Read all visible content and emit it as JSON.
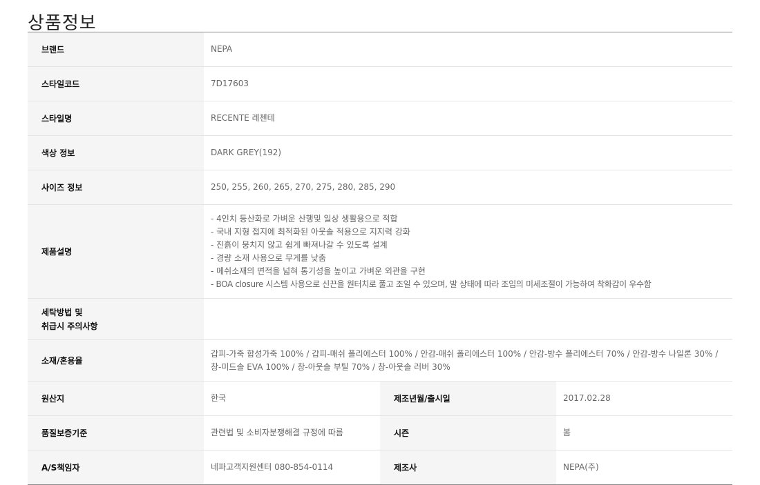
{
  "page_title": "상품정보",
  "rows": {
    "brand": {
      "label": "브랜드",
      "value": "NEPA"
    },
    "style_code": {
      "label": "스타일코드",
      "value": "7D17603"
    },
    "style_name": {
      "label": "스타일명",
      "value": "RECENTE 레첸테"
    },
    "color": {
      "label": "색상 정보",
      "value": "DARK GREY(192)"
    },
    "size": {
      "label": "사이즈 정보",
      "value": "250, 255, 260, 265, 270, 275, 280, 285, 290"
    },
    "description": {
      "label": "제품설명",
      "lines": [
        "- 4인치 등산화로 가벼운 산행및 일상 생활용으로 적합",
        "- 국내 지형 접지에 최적화된 아웃솔 적용으로 지지력 강화",
        "- 진흙이 뭉치지 않고 쉽게 빠져나갈 수 있도록 설계",
        "- 경량 소재 사용으로 무게를 낮춤",
        "- 메쉬소재의 면적을 넓혀 통기성을 높이고 가벼운 외관을 구현",
        "- BOA closure 시스템 사용으로 신끈을 원터치로 풀고 조일 수 있으며, 발 상태에 따라 조임의 미세조절이 가능하여 착화감이 우수함"
      ]
    },
    "care": {
      "label_line1": "세탁방법 및",
      "label_line2": "취급시 주의사항",
      "value": ""
    },
    "material": {
      "label": "소재/혼용율",
      "value": "갑피-가죽 합성가죽 100% / 갑피-매쉬 폴리에스터 100% / 안감-매쉬 폴리에스터 100% / 안감-방수 폴리에스터 70% / 안감-방수 나일론 30% / 창-미드솔 EVA 100% / 창-아웃솔 부틸 70% / 창-아웃솔 러버 30%"
    },
    "origin": {
      "label": "원산지",
      "value": "한국"
    },
    "release": {
      "label": "제조년월/출시일",
      "value": "2017.02.28"
    },
    "warranty": {
      "label": "품질보증기준",
      "value": "관련법 및 소비자분쟁해결 규정에 따름"
    },
    "season": {
      "label": "시즌",
      "value": "봄"
    },
    "as": {
      "label": "A/S책임자",
      "value": "네파고객지원센터 080-854-0114"
    },
    "maker": {
      "label": "제조사",
      "value": "NEPA(주)"
    }
  }
}
